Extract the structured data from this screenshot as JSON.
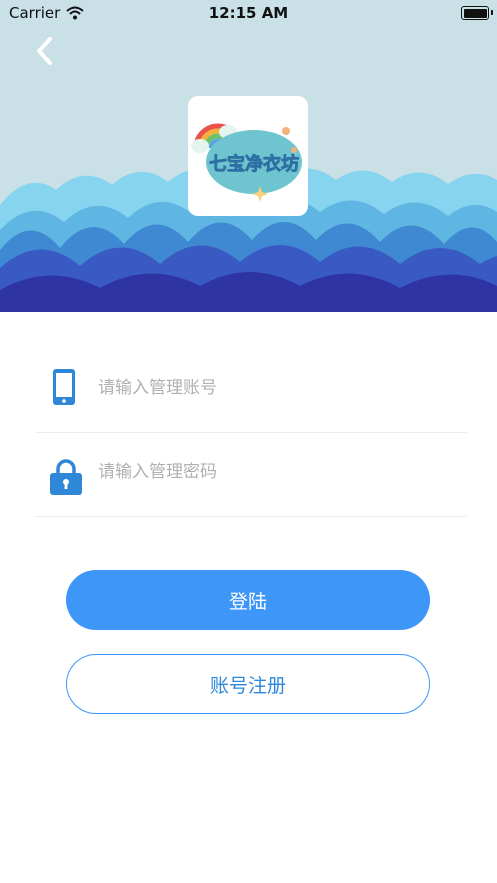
{
  "status_bar": {
    "carrier": "Carrier",
    "time": "12:15 AM"
  },
  "header": {
    "background_color": "#c9e0e6",
    "back_icon": "chevron-left-icon",
    "logo_text": "七宝净衣坊"
  },
  "form": {
    "account_placeholder": "请输入管理账号",
    "account_icon": "smartphone-icon",
    "password_placeholder": "请输入管理密码",
    "password_icon": "lock-icon"
  },
  "buttons": {
    "login_label": "登陆",
    "register_label": "账号注册",
    "accent_color": "#3d96f8"
  }
}
